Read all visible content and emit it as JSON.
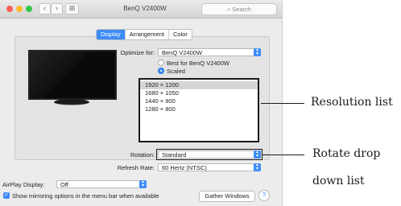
{
  "window": {
    "title": "BenQ V2400W",
    "search_placeholder": "Search",
    "nav_back": "‹",
    "nav_forward": "›",
    "grid_icon": "⊞"
  },
  "tabs": [
    {
      "label": "Display",
      "active": true
    },
    {
      "label": "Arrangement",
      "active": false
    },
    {
      "label": "Color",
      "active": false
    }
  ],
  "optimize": {
    "label": "Optimize for:",
    "value": "BenQ V2400W"
  },
  "radios": [
    {
      "label": "Best for BenQ V2400W",
      "checked": false
    },
    {
      "label": "Scaled",
      "checked": true
    }
  ],
  "resolutions": [
    "1920 × 1200",
    "1680 × 1050",
    "1440 × 900",
    "1280 × 800"
  ],
  "rotation": {
    "label": "Rotation:",
    "value": "Standard"
  },
  "refresh": {
    "label": "Refresh Rate:",
    "value": "60 Hertz (NTSC)"
  },
  "airplay": {
    "label": "AirPlay Display:",
    "value": "Off"
  },
  "mirroring": {
    "label": "Show mirroring options in the menu bar when available",
    "checked": true
  },
  "buttons": {
    "gather": "Gather Windows",
    "help": "?"
  },
  "callouts": {
    "resolution": "Resolution list",
    "rotate_line1": "Rotate drop",
    "rotate_line2": "down list"
  },
  "colors": {
    "accent": "#3d8cf7",
    "traffic_red": "#fc5f57",
    "traffic_yellow": "#fdbc2e",
    "traffic_green": "#34c84a"
  }
}
